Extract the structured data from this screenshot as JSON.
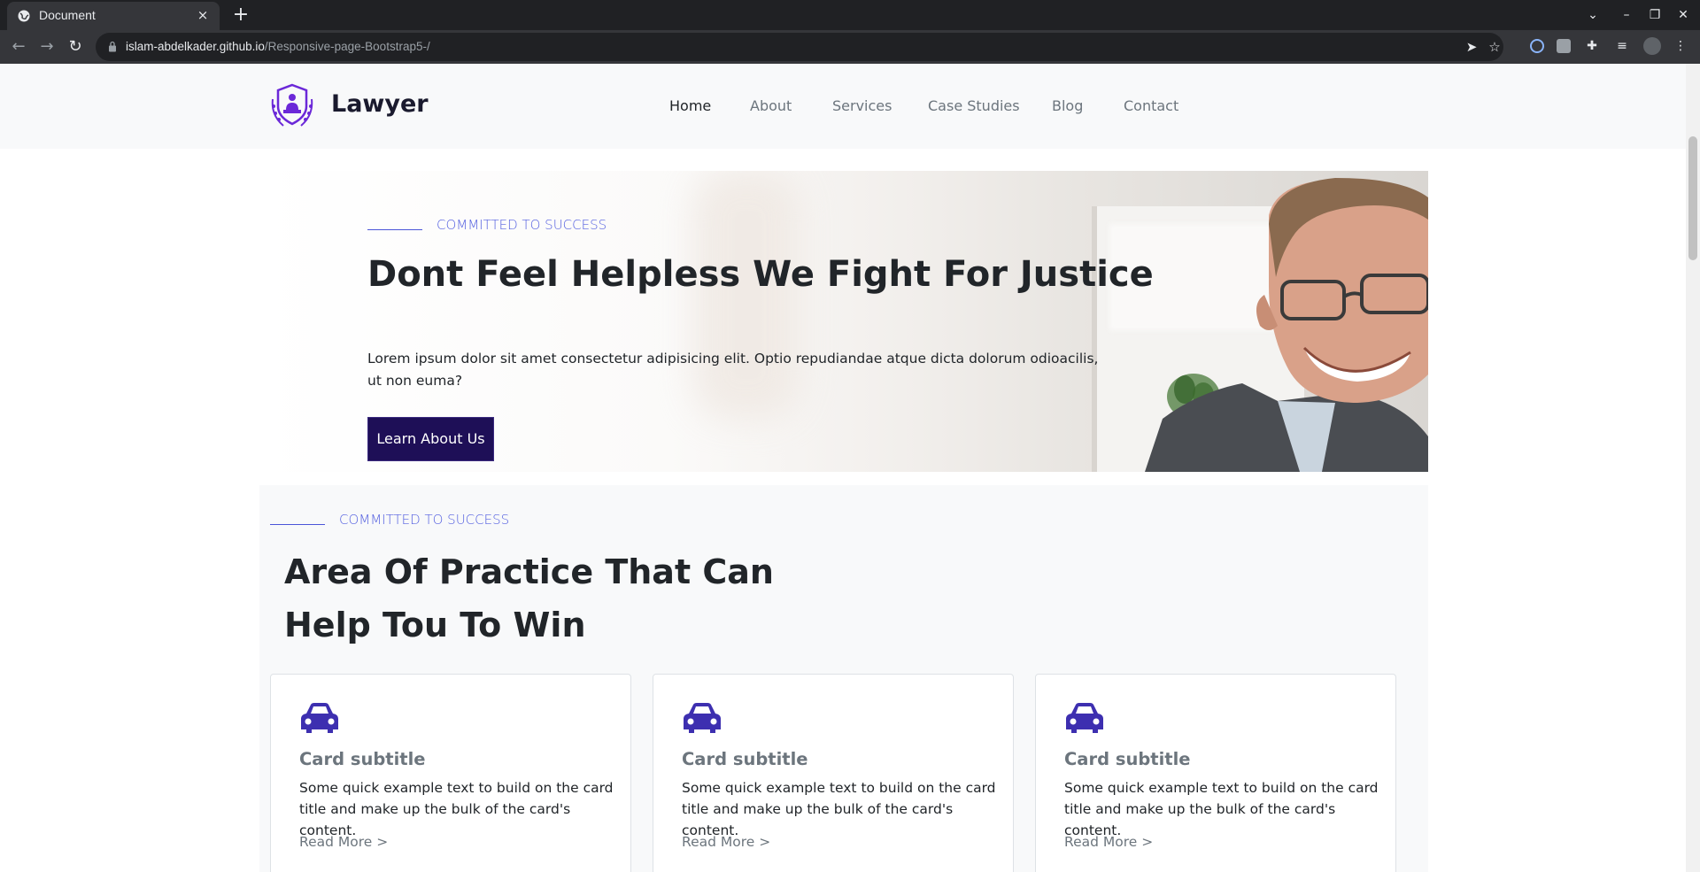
{
  "browser": {
    "tab_title": "Document",
    "tab_close": "×",
    "new_tab": "+",
    "url_host": "islam-abdelkader.github.io",
    "url_path": "/Responsive-page-Bootstrap5-/",
    "icons": [
      "back-arrow-icon",
      "forward-arrow-icon",
      "reload-icon",
      "lock-icon",
      "send-icon",
      "star-icon",
      "extension-icon",
      "puzzle-icon",
      "media-icon",
      "profile-avatar-icon",
      "kebab-menu-icon"
    ]
  },
  "navbar": {
    "brand": "Lawyer",
    "links": [
      "Home",
      "About",
      "Services",
      "Case Studies",
      "Blog",
      "Contact"
    ],
    "active": "Home"
  },
  "hero": {
    "kicker": "COMMITTED TO SUCCESS",
    "title": "Dont Feel Helpless We Fight For Justice",
    "text": "Lorem ipsum dolor sit amet consectetur adipisicing elit. Optio repudiandae atque dicta dolorum odioacilis, ut non euma?",
    "button": "Learn About Us"
  },
  "practice": {
    "kicker": "COMMITTED TO SUCCESS",
    "title": "Area Of Practice That Can Help Tou To Win",
    "cards": [
      {
        "subtitle": "Card subtitle",
        "text": "Some quick example text to build on the card title and make up the bulk of the card's content.",
        "link": "Read More >"
      },
      {
        "subtitle": "Card subtitle",
        "text": "Some quick example text to build on the card title and make up the bulk of the card's content.",
        "link": "Read More >"
      },
      {
        "subtitle": "Card subtitle",
        "text": "Some quick example text to build on the card title and make up the bulk of the card's content.",
        "link": "Read More >"
      }
    ]
  },
  "colors": {
    "accent": "#5460e0",
    "button": "#1e0f57",
    "icon": "#3d2fb0"
  }
}
